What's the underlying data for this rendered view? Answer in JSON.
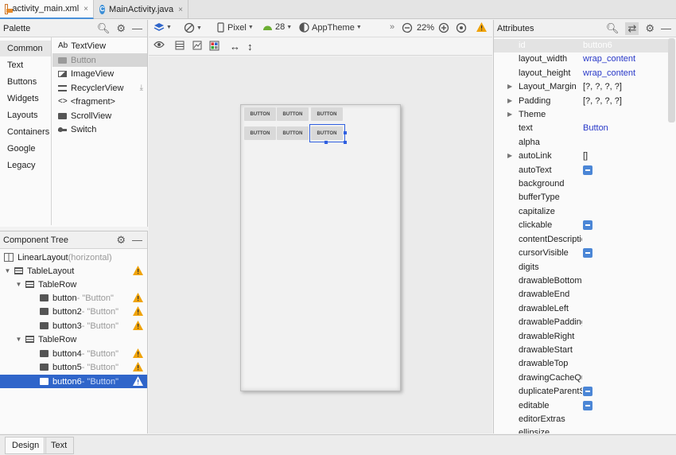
{
  "tabs": [
    {
      "label": "activity_main.xml",
      "close": "×"
    },
    {
      "label": "MainActivity.java",
      "close": "×"
    }
  ],
  "palette": {
    "title": "Palette",
    "categories": [
      "Common",
      "Text",
      "Buttons",
      "Widgets",
      "Layouts",
      "Containers",
      "Google",
      "Legacy"
    ],
    "widgets": [
      {
        "prefix": "Ab",
        "label": "TextView"
      },
      {
        "label": "Button"
      },
      {
        "label": "ImageView"
      },
      {
        "label": "RecyclerView"
      },
      {
        "prefix": "<>",
        "label": "<fragment>"
      },
      {
        "label": "ScrollView"
      },
      {
        "label": "Switch"
      }
    ]
  },
  "tree": {
    "title": "Component Tree",
    "nodes": [
      {
        "label": "LinearLayout",
        "sub": "(horizontal)"
      },
      {
        "label": "TableLayout",
        "sub": ""
      },
      {
        "label": "TableRow",
        "sub": ""
      },
      {
        "label": "button",
        "sub": "- \"Button\""
      },
      {
        "label": "button2",
        "sub": "- \"Button\""
      },
      {
        "label": "button3",
        "sub": "- \"Button\""
      },
      {
        "label": "TableRow",
        "sub": ""
      },
      {
        "label": "button4",
        "sub": "- \"Button\""
      },
      {
        "label": "button5",
        "sub": "- \"Button\""
      },
      {
        "label": "button6",
        "sub": "- \"Button\""
      }
    ]
  },
  "toolbar": {
    "device": "Pixel",
    "api": "28",
    "theme": "AppTheme",
    "chevron": "»",
    "zoom": "22%",
    "warn_color": "#f0a30a"
  },
  "preview": {
    "button_text": "BUTTON"
  },
  "attributes": {
    "title": "Attributes",
    "rows": [
      {
        "key": "id",
        "value": "button6"
      },
      {
        "key": "layout_width",
        "value": "wrap_content"
      },
      {
        "key": "layout_height",
        "value": "wrap_content"
      },
      {
        "key": "Layout_Margin",
        "value": "[?, ?, ?, ?]"
      },
      {
        "key": "Padding",
        "value": "[?, ?, ?, ?]"
      },
      {
        "key": "Theme",
        "value": ""
      },
      {
        "key": "text",
        "value": "Button"
      },
      {
        "key": "alpha",
        "value": ""
      },
      {
        "key": "autoLink",
        "value": "[]"
      },
      {
        "key": "autoText",
        "value": ""
      },
      {
        "key": "background",
        "value": ""
      },
      {
        "key": "bufferType",
        "value": ""
      },
      {
        "key": "capitalize",
        "value": ""
      },
      {
        "key": "clickable",
        "value": ""
      },
      {
        "key": "contentDescription",
        "value": ""
      },
      {
        "key": "cursorVisible",
        "value": ""
      },
      {
        "key": "digits",
        "value": ""
      },
      {
        "key": "drawableBottom",
        "value": ""
      },
      {
        "key": "drawableEnd",
        "value": ""
      },
      {
        "key": "drawableLeft",
        "value": ""
      },
      {
        "key": "drawablePadding",
        "value": ""
      },
      {
        "key": "drawableRight",
        "value": ""
      },
      {
        "key": "drawableStart",
        "value": ""
      },
      {
        "key": "drawableTop",
        "value": ""
      },
      {
        "key": "drawingCacheQuality",
        "value": ""
      },
      {
        "key": "duplicateParentState",
        "value": ""
      },
      {
        "key": "editable",
        "value": ""
      },
      {
        "key": "editorExtras",
        "value": ""
      },
      {
        "key": "ellipsize",
        "value": ""
      }
    ]
  },
  "bottom_tabs": [
    "Design",
    "Text"
  ],
  "colors": {
    "selection": "#2f65ca",
    "accent": "#2f5fe0",
    "value_text": "#2838c8"
  }
}
